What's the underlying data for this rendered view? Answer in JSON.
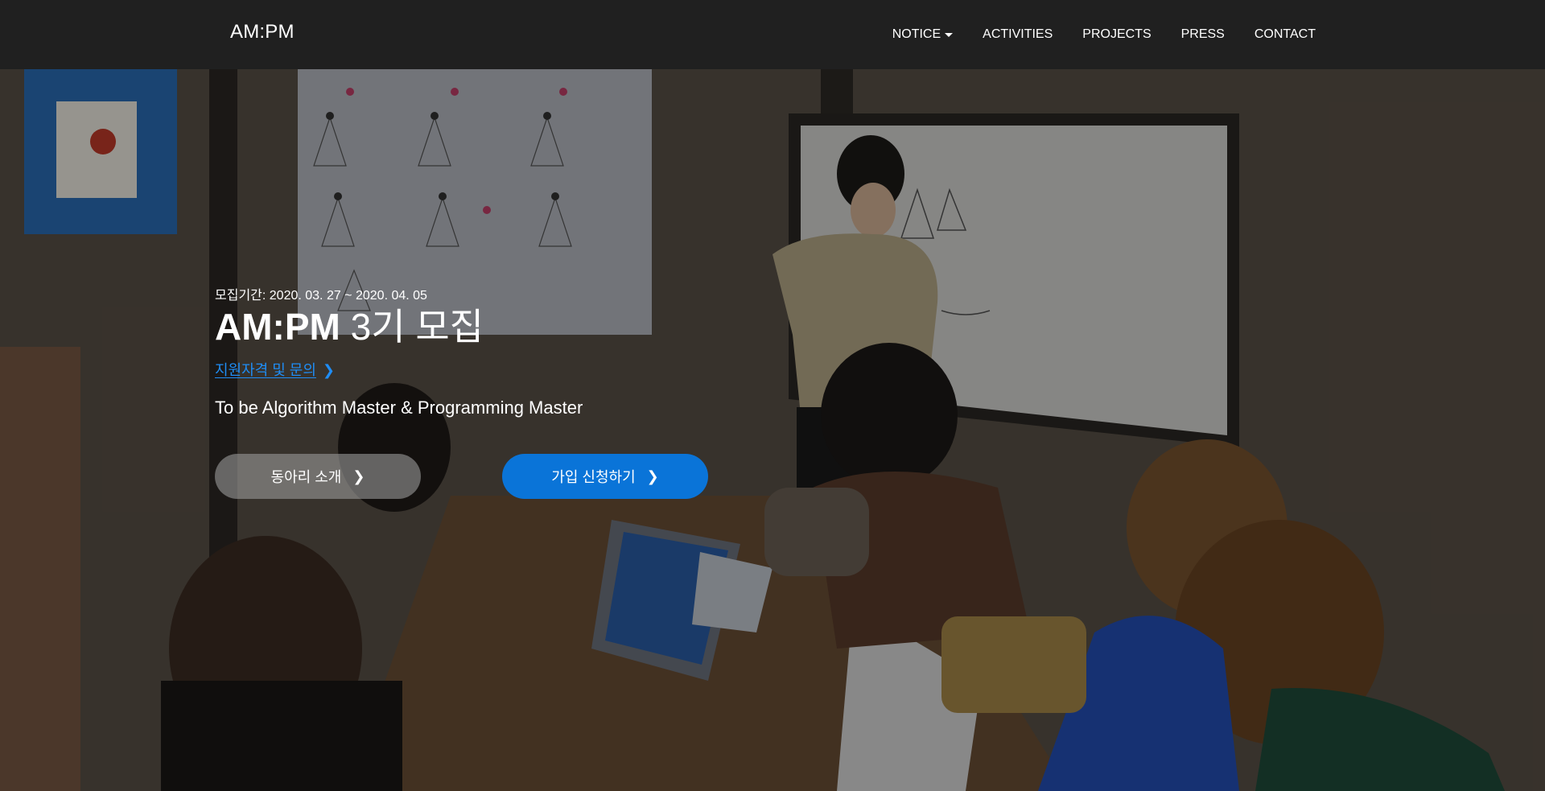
{
  "navbar": {
    "brand": "AM:PM",
    "items": [
      {
        "label": "NOTICE",
        "dropdown": true
      },
      {
        "label": "ACTIVITIES"
      },
      {
        "label": "PROJECTS"
      },
      {
        "label": "PRESS"
      },
      {
        "label": "CONTACT"
      }
    ]
  },
  "hero": {
    "period": "모집기간: 2020. 03. 27 ~ 2020. 04. 05",
    "headline_bold": "AM:PM",
    "headline_light": "3기 모집",
    "apply_link": "지원자격 및 문의",
    "tagline": "To be Algorithm Master & Programming Master",
    "buttons": {
      "intro": "동아리 소개",
      "join": "가입 신청하기"
    }
  },
  "colors": {
    "navbar_bg": "#202020",
    "link_blue": "#1f8df5",
    "primary_button": "#0a74d8",
    "secondary_button": "#969696"
  },
  "icons": {
    "chevron": "chevron-right-icon",
    "caret": "caret-down-icon"
  }
}
